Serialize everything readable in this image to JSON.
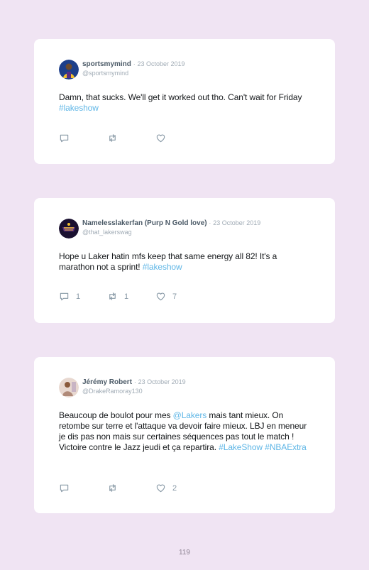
{
  "tweets": [
    {
      "name": "sportsmymind",
      "date": "23 October 2019",
      "handle": "@sportsmymind",
      "text_parts": [
        {
          "text": "Damn, that sucks. We'll get it worked out tho. Can't wait for Friday ",
          "tag": false
        },
        {
          "text": "#lakeshow",
          "tag": true
        }
      ],
      "replies": "",
      "retweets": "",
      "likes": ""
    },
    {
      "name": "Namelesslakerfan (Purp N Gold love)",
      "date": "23 October 2019",
      "handle": "@that_lakerswag",
      "text_parts": [
        {
          "text": "Hope u Laker hatin mfs keep that same energy all 82! It's a marathon not a sprint! ",
          "tag": false
        },
        {
          "text": "#lakeshow",
          "tag": true
        }
      ],
      "replies": "1",
      "retweets": "1",
      "likes": "7"
    },
    {
      "name": "Jérémy Robert",
      "date": "23 October 2019",
      "handle": "@DrakeRamoray130",
      "text_parts": [
        {
          "text": "Beaucoup de boulot pour mes ",
          "tag": false
        },
        {
          "text": "@Lakers",
          "tag": true
        },
        {
          "text": " mais tant mieux. On retombe sur terre et l'attaque va devoir faire mieux. LBJ en meneur je dis pas non mais sur certaines séquences pas tout le match ! Victoire contre le Jazz jeudi et ça repartira. ",
          "tag": false
        },
        {
          "text": "#LakeShow",
          "tag": true
        },
        {
          "text": " ",
          "tag": false
        },
        {
          "text": "#NBAExtra",
          "tag": true
        }
      ],
      "replies": "",
      "retweets": "",
      "likes": "2"
    }
  ],
  "separator": "·",
  "page_number": "119",
  "colors": {
    "background": "#f0e4f3",
    "hashtag": "#5fb6e6",
    "name": "#4a5966",
    "muted": "#a0abb5"
  },
  "icons": {
    "reply": "reply-icon",
    "retweet": "retweet-icon",
    "like": "heart-icon"
  }
}
